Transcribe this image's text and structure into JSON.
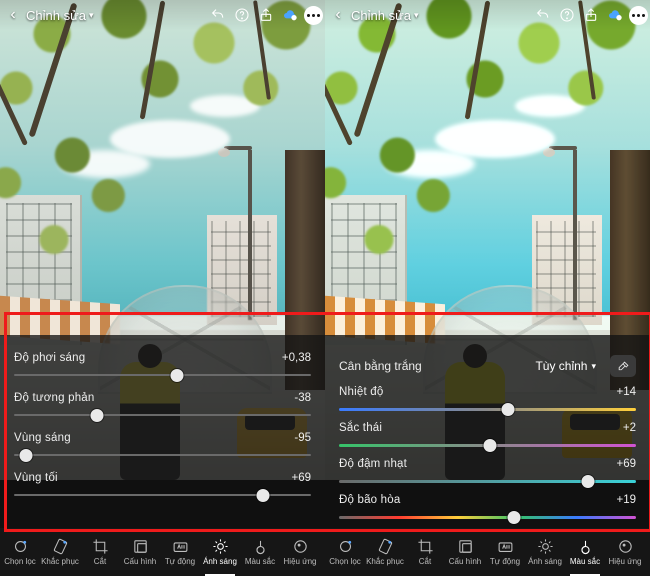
{
  "header": {
    "title": "Chỉnh sửa"
  },
  "left": {
    "sliders": [
      {
        "label": "Độ phơi sáng",
        "value": "+0,38",
        "pos": 55
      },
      {
        "label": "Độ tương phản",
        "value": "-38",
        "pos": 28
      },
      {
        "label": "Vùng sáng",
        "value": "-95",
        "pos": 4
      },
      {
        "label": "Vùng tối",
        "value": "+69",
        "pos": 84
      }
    ]
  },
  "right": {
    "wb_label": "Cân bằng trắng",
    "wb_value": "Tùy chỉnh",
    "sliders": [
      {
        "label": "Nhiệt độ",
        "value": "+14",
        "pos": 57,
        "grad": "temp"
      },
      {
        "label": "Sắc thái",
        "value": "+2",
        "pos": 51,
        "grad": "tint"
      },
      {
        "label": "Độ đậm nhạt",
        "value": "+69",
        "pos": 84,
        "grad": "vib"
      },
      {
        "label": "Độ bão hòa",
        "value": "+19",
        "pos": 59,
        "grad": "sat"
      }
    ]
  },
  "toolbar": [
    {
      "key": "select",
      "label": "Chọn lọc"
    },
    {
      "key": "heal",
      "label": "Khắc phục"
    },
    {
      "key": "crop",
      "label": "Cắt"
    },
    {
      "key": "profile",
      "label": "Cấu hình"
    },
    {
      "key": "auto",
      "label": "Tự động"
    },
    {
      "key": "light",
      "label": "Ánh sáng"
    },
    {
      "key": "color",
      "label": "Màu sắc"
    },
    {
      "key": "effect",
      "label": "Hiệu ứng"
    }
  ],
  "active": {
    "left": "light",
    "right": "color"
  }
}
